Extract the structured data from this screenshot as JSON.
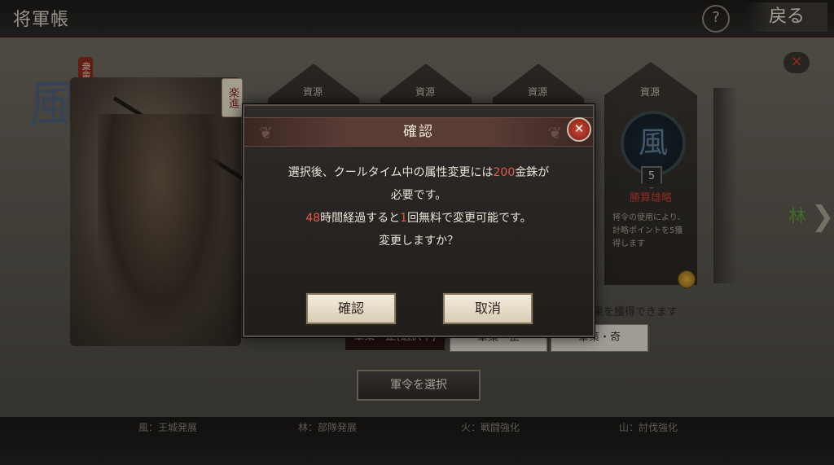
{
  "header": {
    "title": "将軍帳",
    "help_label": "?",
    "back_label": "戻る"
  },
  "general": {
    "seal_char": "風",
    "red_stamp": "衆輩",
    "name": "楽進"
  },
  "cards": {
    "items": [
      {
        "label": "資源"
      },
      {
        "label": "資源"
      },
      {
        "label": "資源"
      },
      {
        "label": "資源"
      }
    ],
    "featured": {
      "token_char": "風",
      "level": "5",
      "title": "勝算雄略",
      "description": "将令の使用により、計略ポイントを5獲得します"
    },
    "next_char": "林"
  },
  "obtain_text": "果を獲得できます",
  "tabs": [
    {
      "label": "軍策・正(選択中)"
    },
    {
      "label": "軍策・正"
    },
    {
      "label": "軍策・奇"
    }
  ],
  "select_order_label": "軍令を選択",
  "bottom_labels": [
    "風：王城発展",
    "林：部隊発展",
    "火：戦闘強化",
    "山：討伐強化"
  ],
  "dialog": {
    "title": "確認",
    "close_label": "✕",
    "line1_pre": "選択後、クールタイム中の属性変更には",
    "line1_num": "200",
    "line1_post": "金銖が",
    "line2": "必要です。",
    "line3_num1": "48",
    "line3_mid": "時間経過すると",
    "line3_num2": "1",
    "line3_post": "回無料で変更可能です。",
    "line4": "変更しますか？",
    "confirm_label": "確認",
    "cancel_label": "取消"
  },
  "colors": {
    "accent_red": "#e05a4a",
    "close_red": "#c03a2a"
  }
}
